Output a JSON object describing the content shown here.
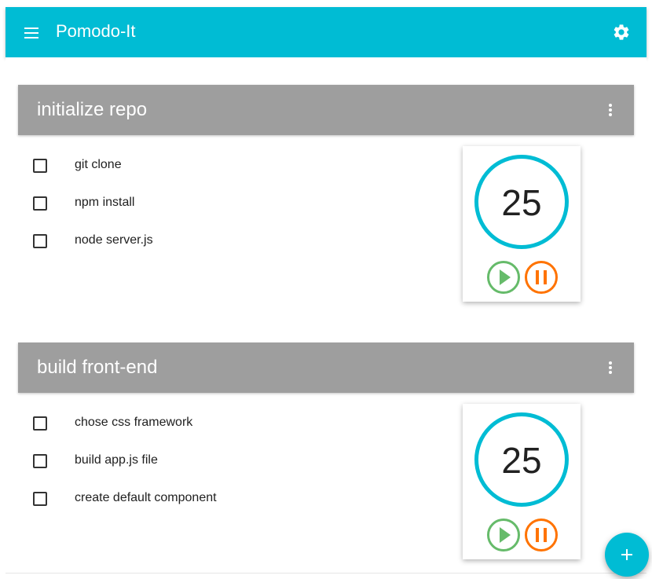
{
  "app": {
    "title": "Pomodo-It"
  },
  "icons": {
    "menu": "menu-icon",
    "settings": "gear-icon",
    "more": "more-vert-icon",
    "play": "play-icon",
    "pause": "pause-icon",
    "add": "plus-icon"
  },
  "colors": {
    "appbar": "#00bcd4",
    "card_header": "#9e9e9e",
    "timer_ring": "#00bcd4",
    "play": "#66bb6a",
    "pause": "#ff7300",
    "fab": "#00bcd4"
  },
  "projects": [
    {
      "title": "initialize repo",
      "tasks": [
        "git clone",
        "npm install",
        "node server.js"
      ],
      "timer": "25"
    },
    {
      "title": "build front-end",
      "tasks": [
        "chose css framework",
        "build app.js file",
        "create default component"
      ],
      "timer": "25"
    }
  ]
}
